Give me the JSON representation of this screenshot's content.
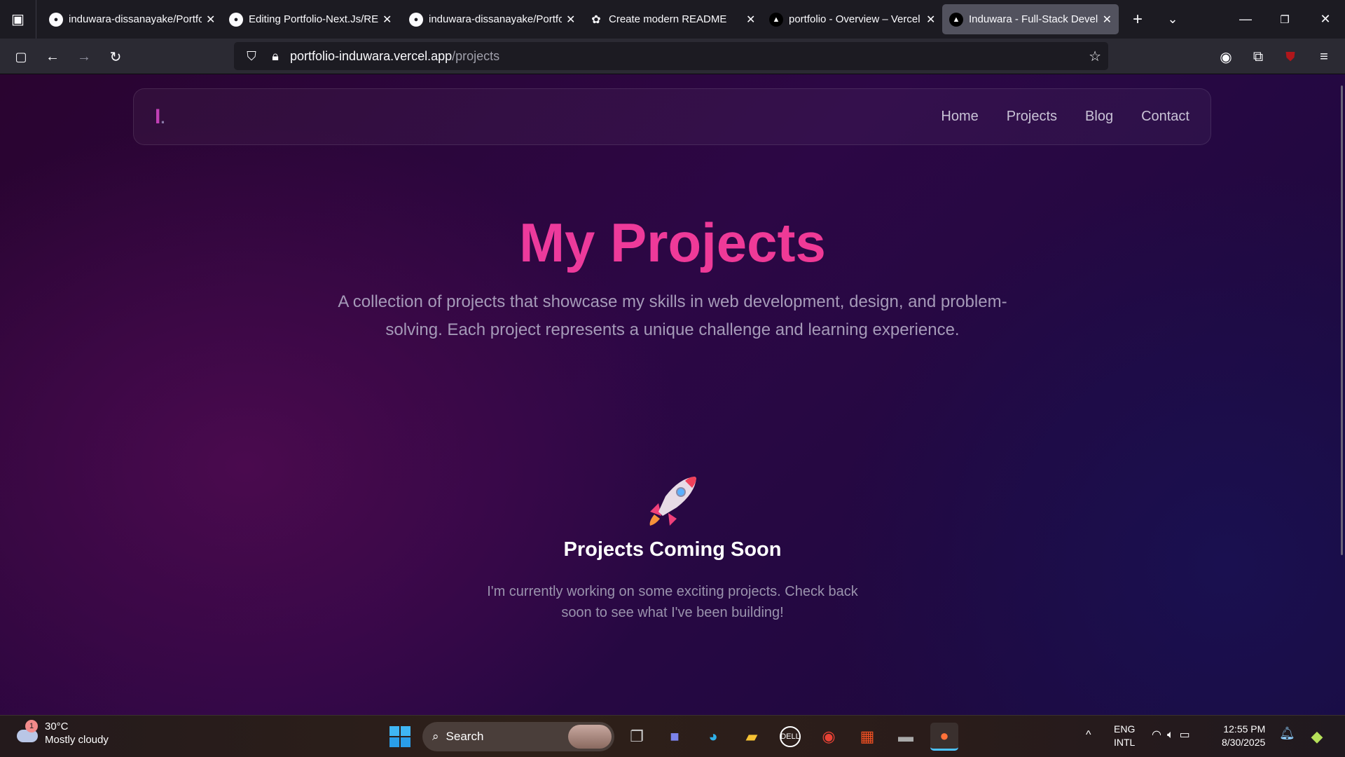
{
  "browser": {
    "tabs": [
      {
        "title": "induwara-dissanayake/Portfo",
        "icon": "github-icon",
        "active": false
      },
      {
        "title": "Editing Portfolio-Next.Js/README",
        "icon": "github-icon",
        "active": false
      },
      {
        "title": "induwara-dissanayake/Portfo",
        "icon": "github-icon",
        "active": false
      },
      {
        "title": "Create modern README",
        "icon": "chatgpt-icon",
        "active": false
      },
      {
        "title": "portfolio - Overview – Vercel",
        "icon": "vercel-icon",
        "active": false
      },
      {
        "title": "Induwara - Full-Stack Developer",
        "icon": "vercel-icon",
        "active": true
      }
    ],
    "url_host": "portfolio-induwara.vercel.app",
    "url_path": "/projects"
  },
  "site": {
    "logo": "I",
    "logo_dot": ".",
    "nav": [
      "Home",
      "Projects",
      "Blog",
      "Contact"
    ],
    "title": "My Projects",
    "subtitle": "A collection of projects that showcase my skills in web development, design, and problem-solving. Each project represents a unique challenge and learning experience.",
    "empty_title": "Projects Coming Soon",
    "empty_desc": "I'm currently working on some exciting projects. Check back soon to see what I've been building!"
  },
  "taskbar": {
    "weather_badge": "1",
    "temperature": "30°C",
    "condition": "Mostly cloudy",
    "search": "Search",
    "lang1": "ENG",
    "lang2": "INTL",
    "time": "12:55 PM",
    "date": "8/30/2025"
  },
  "colors": {
    "accent": "#f0399b",
    "logo": "#c13fb5"
  }
}
